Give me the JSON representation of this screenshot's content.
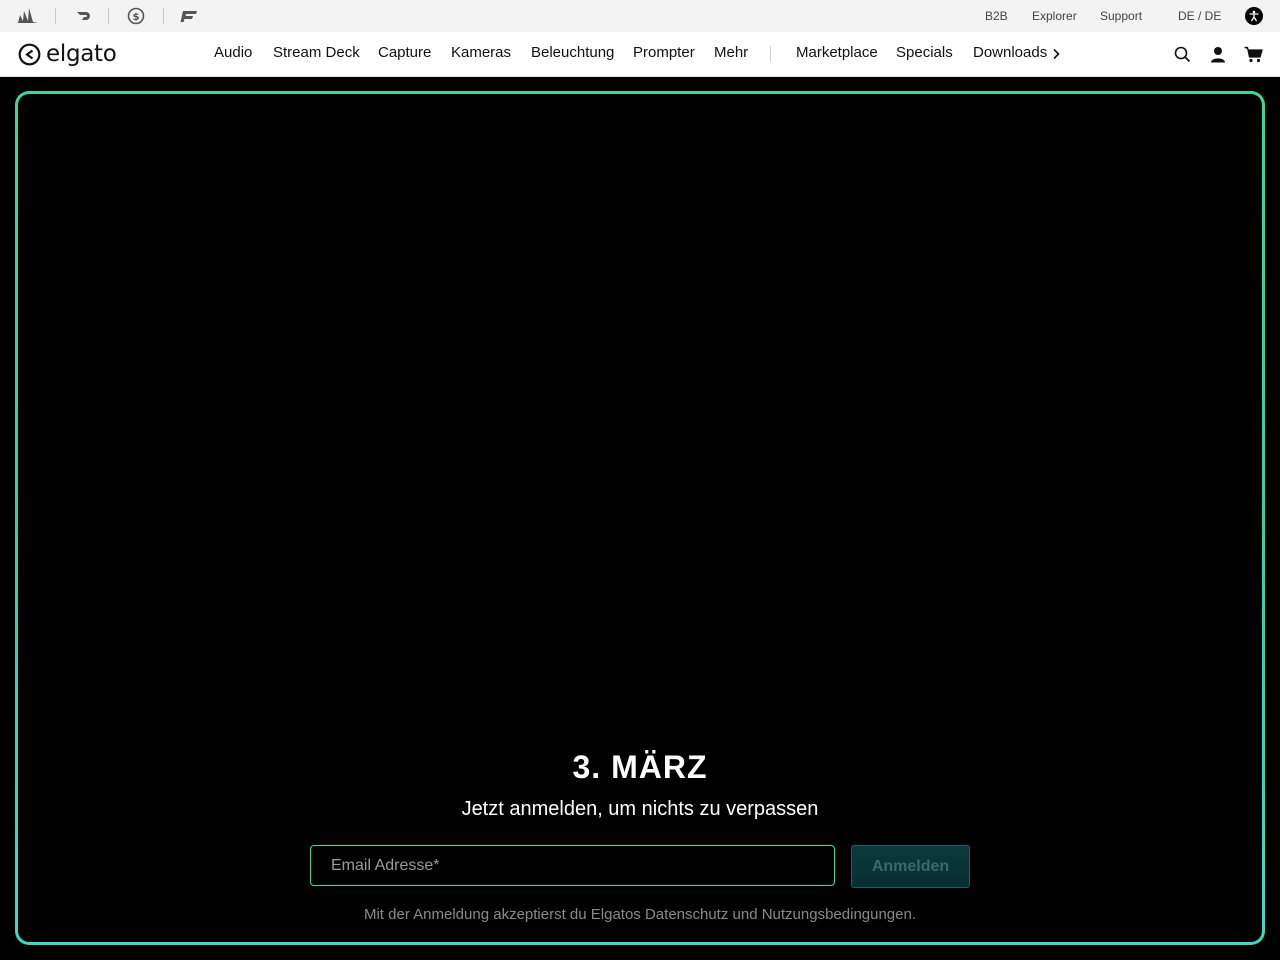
{
  "brands": [
    "corsair-logo",
    "scuf-logo",
    "dollar-circle-logo",
    "fanatec-logo"
  ],
  "utility_nav": {
    "b2b": "B2B",
    "explorer": "Explorer",
    "support": "Support",
    "locale": "DE / DE"
  },
  "logo": {
    "text": "elgato"
  },
  "nav": {
    "audio": "Audio",
    "stream_deck": "Stream Deck",
    "capture": "Capture",
    "kameras": "Kameras",
    "beleuchtung": "Beleuchtung",
    "prompter": "Prompter",
    "mehr": "Mehr",
    "marketplace": "Marketplace",
    "specials": "Specials",
    "downloads": "Downloads"
  },
  "hero": {
    "title": "3. MÄRZ",
    "subtitle": "Jetzt anmelden, um nichts zu verpassen",
    "email_placeholder": "Email Adresse*",
    "submit_label": "Anmelden",
    "legal": "Mit der Anmeldung akzeptierst du Elgatos Datenschutz und Nutzungsbedingungen."
  },
  "colors": {
    "hero_border": "#3ad79a",
    "submit_bg": "#0a3a3c",
    "submit_text": "#3b6a69",
    "legal_text": "#8a8a8a"
  }
}
